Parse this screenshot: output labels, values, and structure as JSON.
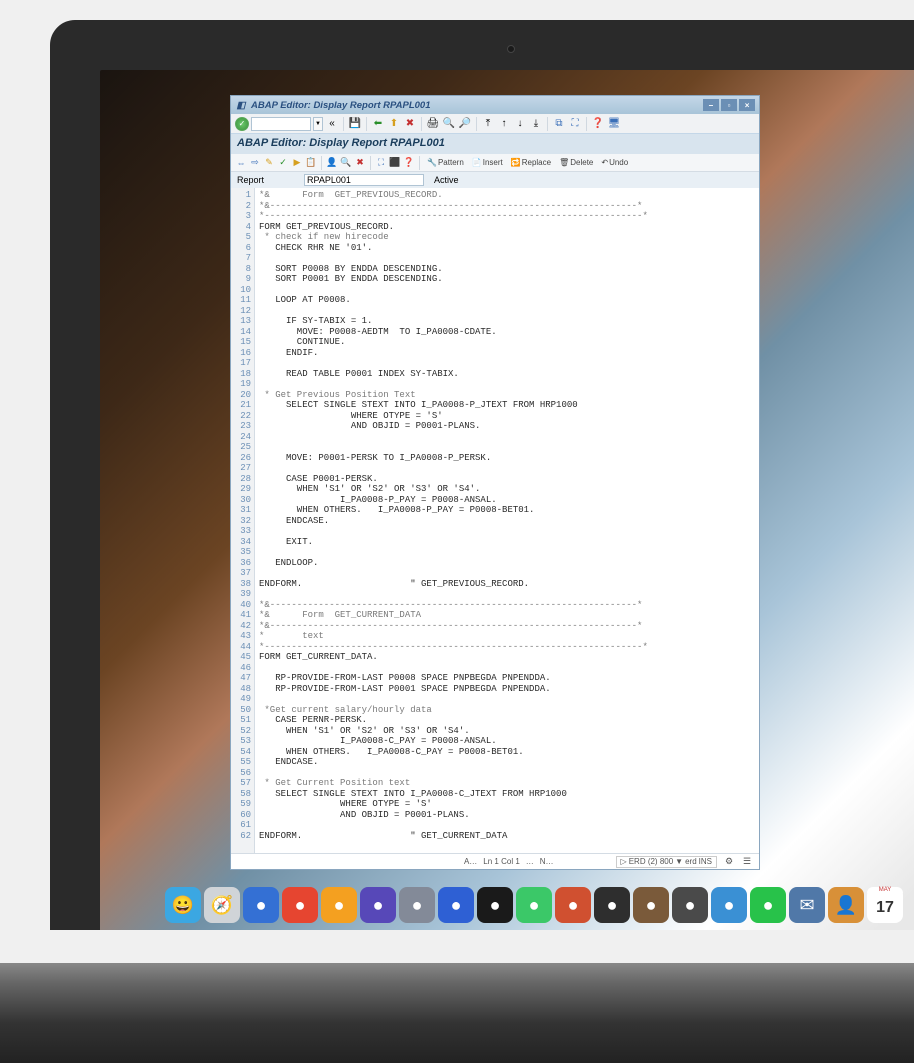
{
  "window": {
    "title": "ABAP Editor: Display Report RPAPL001",
    "subtitle": "ABAP Editor: Display Report RPAPL001"
  },
  "toolbar": {
    "command_value": "",
    "icons": {
      "check": "✓",
      "back": "◀",
      "nav": "«",
      "save": "💾",
      "reload": "🔄"
    }
  },
  "actionbar": {
    "pattern": "Pattern",
    "insert": "Insert",
    "replace": "Replace",
    "delete": "Delete",
    "undo": "Undo"
  },
  "report": {
    "label": "Report",
    "value": "RPAPL001",
    "status": "Active"
  },
  "code": {
    "lines": [
      "*&      Form  GET_PREVIOUS_RECORD.",
      "*&--------------------------------------------------------------------*",
      "*----------------------------------------------------------------------*",
      "FORM GET_PREVIOUS_RECORD.",
      " * check if new hirecode",
      "   CHECK RHR NE '01'.",
      "",
      "   SORT P0008 BY ENDDA DESCENDING.",
      "   SORT P0001 BY ENDDA DESCENDING.",
      "",
      "   LOOP AT P0008.",
      "",
      "     IF SY-TABIX = 1.",
      "       MOVE: P0008-AEDTM  TO I_PA0008-CDATE.",
      "       CONTINUE.",
      "     ENDIF.",
      "",
      "     READ TABLE P0001 INDEX SY-TABIX.",
      "",
      " * Get Previous Position Text",
      "     SELECT SINGLE STEXT INTO I_PA0008-P_JTEXT FROM HRP1000",
      "                 WHERE OTYPE = 'S'",
      "                 AND OBJID = P0001-PLANS.",
      "",
      "",
      "     MOVE: P0001-PERSK TO I_PA0008-P_PERSK.",
      "",
      "     CASE P0001-PERSK.",
      "       WHEN 'S1' OR 'S2' OR 'S3' OR 'S4'.",
      "               I_PA0008-P_PAY = P0008-ANSAL.",
      "       WHEN OTHERS.   I_PA0008-P_PAY = P0008-BET01.",
      "     ENDCASE.",
      "",
      "     EXIT.",
      "",
      "   ENDLOOP.",
      "",
      "ENDFORM.                    \" GET_PREVIOUS_RECORD.",
      "",
      "*&--------------------------------------------------------------------*",
      "*&      Form  GET_CURRENT_DATA",
      "*&--------------------------------------------------------------------*",
      "*       text",
      "*----------------------------------------------------------------------*",
      "FORM GET_CURRENT_DATA.",
      "",
      "   RP-PROVIDE-FROM-LAST P0008 SPACE PNPBEGDA PNPENDDA.",
      "   RP-PROVIDE-FROM-LAST P0001 SPACE PNPBEGDA PNPENDDA.",
      "",
      " *Get current salary/hourly data",
      "   CASE PERNR-PERSK.",
      "     WHEN 'S1' OR 'S2' OR 'S3' OR 'S4'.",
      "               I_PA0008-C_PAY = P0008-ANSAL.",
      "     WHEN OTHERS.   I_PA0008-C_PAY = P0008-BET01.",
      "   ENDCASE.",
      "",
      " * Get Current Position text",
      "   SELECT SINGLE STEXT INTO I_PA0008-C_JTEXT FROM HRP1000",
      "               WHERE OTYPE = 'S'",
      "               AND OBJID = P0001-PLANS.",
      "",
      "ENDFORM.                    \" GET_CURRENT_DATA"
    ]
  },
  "status": {
    "left_indicator": "A…",
    "position": "Ln  1 Col  1",
    "lines": "…",
    "indicator": "N…",
    "system_arrow": "▷",
    "system": "ERD (2) 800",
    "server_arrow": "▼",
    "server": "erd",
    "mode": "INS"
  },
  "dock": {
    "items": [
      {
        "name": "finder",
        "bg": "#3ba7e2",
        "glyph": "😀"
      },
      {
        "name": "safari",
        "bg": "#d0d4d8",
        "glyph": "🧭"
      },
      {
        "name": "app1",
        "bg": "#3470d4",
        "glyph": "●"
      },
      {
        "name": "app2",
        "bg": "#e64530",
        "glyph": "●"
      },
      {
        "name": "app3",
        "bg": "#f4a020",
        "glyph": "●"
      },
      {
        "name": "app4",
        "bg": "#5748b8",
        "glyph": "●"
      },
      {
        "name": "app5",
        "bg": "#838a98",
        "glyph": "●"
      },
      {
        "name": "app6",
        "bg": "#2e60d4",
        "glyph": "●"
      },
      {
        "name": "app7",
        "bg": "#1a1a1a",
        "glyph": "●"
      },
      {
        "name": "app8",
        "bg": "#3bc868",
        "glyph": "●"
      },
      {
        "name": "app9",
        "bg": "#d05030",
        "glyph": "●"
      },
      {
        "name": "app10",
        "bg": "#2e2e2e",
        "glyph": "●"
      },
      {
        "name": "app11",
        "bg": "#7a5a3a",
        "glyph": "●"
      },
      {
        "name": "app12",
        "bg": "#4a4a4a",
        "glyph": "●"
      },
      {
        "name": "app13",
        "bg": "#3a90d4",
        "glyph": "●"
      },
      {
        "name": "whatsapp",
        "bg": "#28c24a",
        "glyph": "●"
      },
      {
        "name": "mail",
        "bg": "#5078a8",
        "glyph": "✉"
      },
      {
        "name": "contacts",
        "bg": "#d89038",
        "glyph": "👤"
      },
      {
        "name": "calendar",
        "bg": "#ffffff",
        "glyph": "17",
        "top": "MAY"
      }
    ]
  }
}
